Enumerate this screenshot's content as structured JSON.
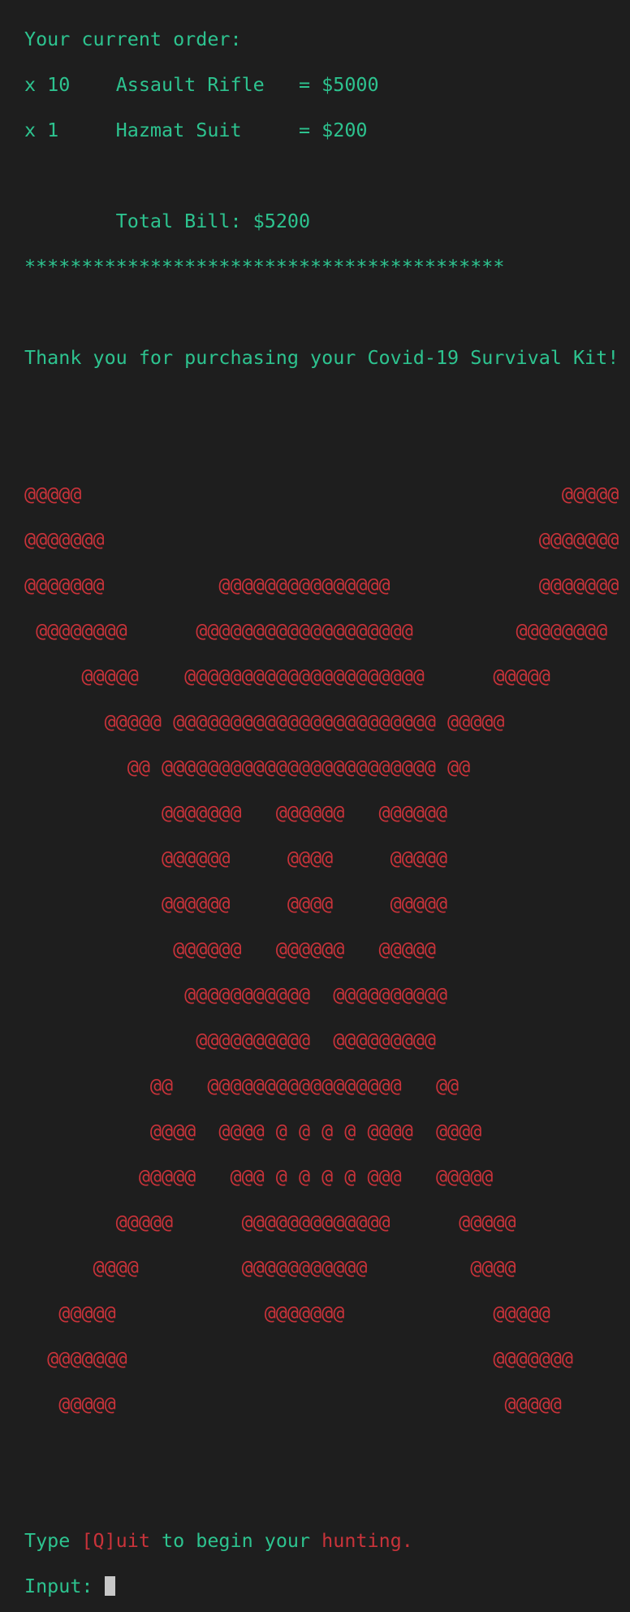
{
  "order": {
    "header": "Your current order:",
    "items": [
      {
        "qty": "x 10",
        "name": "Assault Rifle",
        "price": "= $5000"
      },
      {
        "qty": "x 1",
        "name": "Hazmat Suit",
        "price": "= $200"
      }
    ],
    "total": "Total Bill: $5200",
    "separator": "******************************************"
  },
  "thanks": "Thank you for purchasing your Covid-19 Survival Kit!",
  "art_lines": [
    "@@@@@                                          @@@@@",
    "@@@@@@@                                      @@@@@@@",
    "@@@@@@@          @@@@@@@@@@@@@@@             @@@@@@@",
    " @@@@@@@@      @@@@@@@@@@@@@@@@@@@         @@@@@@@@",
    "     @@@@@    @@@@@@@@@@@@@@@@@@@@@      @@@@@",
    "       @@@@@ @@@@@@@@@@@@@@@@@@@@@@@ @@@@@",
    "         @@ @@@@@@@@@@@@@@@@@@@@@@@@ @@",
    "            @@@@@@@   @@@@@@   @@@@@@",
    "            @@@@@@     @@@@     @@@@@",
    "            @@@@@@     @@@@     @@@@@",
    "             @@@@@@   @@@@@@   @@@@@",
    "              @@@@@@@@@@@  @@@@@@@@@@",
    "               @@@@@@@@@@  @@@@@@@@@",
    "           @@   @@@@@@@@@@@@@@@@@   @@",
    "           @@@@  @@@@ @ @ @ @ @@@@  @@@@",
    "          @@@@@   @@@ @ @ @ @ @@@   @@@@@",
    "        @@@@@      @@@@@@@@@@@@@      @@@@@",
    "      @@@@         @@@@@@@@@@@         @@@@",
    "   @@@@@             @@@@@@@             @@@@@",
    "  @@@@@@@                                @@@@@@@",
    "   @@@@@                                  @@@@@"
  ],
  "prompt": {
    "type_word": "Type ",
    "quit_key": "[Q]",
    "quit_rest": "uit",
    "to_begin": " to begin your ",
    "hunting": "hunting.",
    "input_label": "Input: "
  }
}
